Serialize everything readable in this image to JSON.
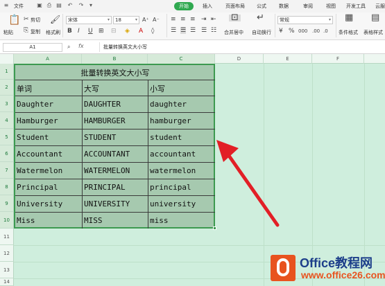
{
  "topbar": {
    "menu_label": "文件",
    "tabs": [
      "开始",
      "插入",
      "页面布局",
      "公式",
      "数据",
      "审阅",
      "视图",
      "开发工具",
      "云服"
    ]
  },
  "ribbon": {
    "cut": "剪切",
    "copy": "复制",
    "paste": "粘贴",
    "format_painter": "格式刷",
    "font_name": "宋体",
    "font_size": "18",
    "merge_center": "合并居中",
    "wrap_text": "自动换行",
    "number_format": "常规",
    "conditional_format": "条件格式",
    "table_style": "表格样式"
  },
  "formula_bar": {
    "cell_ref": "A1",
    "fx": "fx",
    "content": "批量转换英文大小写"
  },
  "columns": [
    "A",
    "B",
    "C",
    "D",
    "E",
    "F"
  ],
  "rows": [
    "1",
    "2",
    "3",
    "4",
    "5",
    "6",
    "7",
    "8",
    "9",
    "10",
    "11",
    "12",
    "13",
    "14"
  ],
  "table": {
    "title": "批量转换英文大小写",
    "headers": [
      "单词",
      "大写",
      "小写"
    ],
    "rows": [
      [
        "Daughter",
        "DAUGHTER",
        "daughter"
      ],
      [
        "Hamburger",
        "HAMBURGER",
        "hamburger"
      ],
      [
        "Student",
        "STUDENT",
        "student"
      ],
      [
        "Accountant",
        "ACCOUNTANT",
        "accountant"
      ],
      [
        "Watermelon",
        "WATERMELON",
        "watermelon"
      ],
      [
        "Principal",
        "PRINCIPAL",
        "principal"
      ],
      [
        "University",
        "UNIVERSITY",
        "university"
      ],
      [
        "Miss",
        "MISS",
        "miss"
      ]
    ]
  },
  "logo": {
    "brand": "Office教程网",
    "url": "www.office26.com"
  },
  "colors": {
    "accent": "#2fa84f",
    "arrow": "#e21f26",
    "selection_fill": "#a6c9af",
    "sheet_bg": "#cfeedd"
  }
}
